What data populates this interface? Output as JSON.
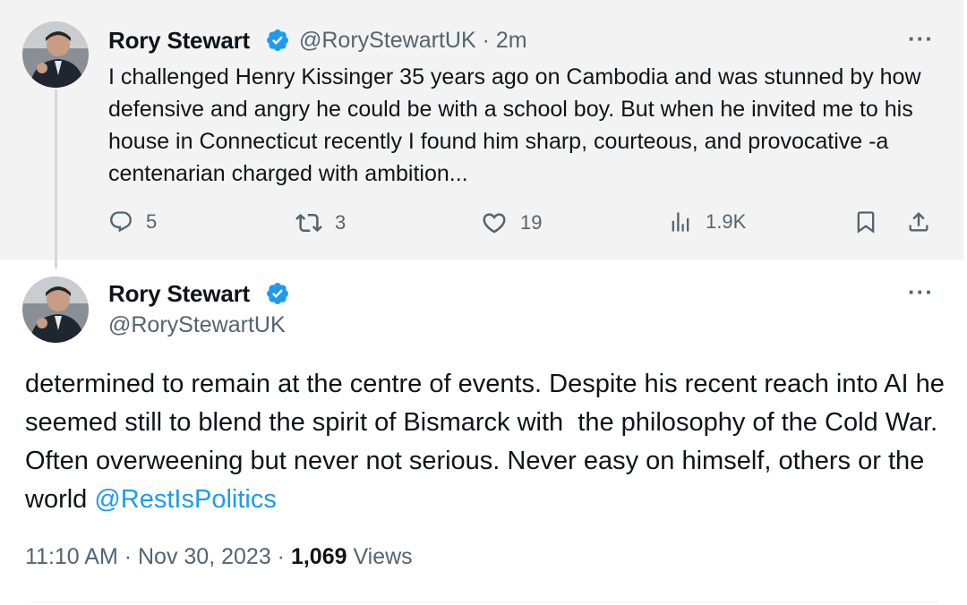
{
  "parent_tweet": {
    "author_name": "Rory Stewart",
    "handle": "@RoryStewartUK",
    "separator": "·",
    "time_ago": "2m",
    "text": "I challenged Henry Kissinger 35 years ago on Cambodia and was stunned by how defensive and angry he could be with a school boy. But when he invited me to his house in Connecticut recently I found him sharp, courteous, and provocative -a centenarian charged with ambition...",
    "replies": "5",
    "reposts": "3",
    "likes": "19",
    "views": "1.9K",
    "more_label": "···"
  },
  "main_tweet": {
    "author_name": "Rory Stewart",
    "handle": "@RoryStewartUK",
    "more_label": "···",
    "text": "determined to remain at the centre of events. Despite his recent reach into AI he seemed still to blend the spirit of Bismarck with  the philosophy of the Cold War. Often overweening but never not serious. Never easy on himself, others or the world ",
    "mention": "@RestIsPolitics",
    "time": "11:10 AM",
    "dot1": " · ",
    "date": "Nov 30, 2023",
    "dot2": " · ",
    "view_count": "1,069",
    "views_label": " Views"
  },
  "icons": [
    "verified-badge-icon",
    "reply-icon",
    "repost-icon",
    "like-icon",
    "views-icon",
    "bookmark-icon",
    "share-icon",
    "more-icon"
  ],
  "colors": {
    "accent": "#1d9bf0",
    "secondary_text": "#536471",
    "primary_text": "#0f1419",
    "parent_bg": "#f3f3f3"
  }
}
